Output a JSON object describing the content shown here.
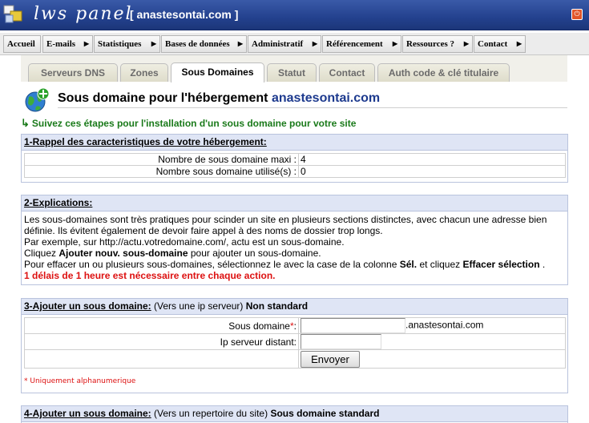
{
  "header": {
    "logo_text": "lws panel",
    "domain_title": "[ anastesontai.com ]",
    "power_icon": "power-icon"
  },
  "menu": [
    {
      "label": "Accueil"
    },
    {
      "label": "E-mails"
    },
    {
      "label": "Statistiques"
    },
    {
      "label": "Bases de données"
    },
    {
      "label": "Administratif"
    },
    {
      "label": "Référencement"
    },
    {
      "label": "Ressources ?"
    },
    {
      "label": "Contact"
    }
  ],
  "tabs": [
    {
      "label": "Serveurs DNS"
    },
    {
      "label": "Zones"
    },
    {
      "label": "Sous Domaines",
      "active": true
    },
    {
      "label": "Statut"
    },
    {
      "label": "Contact"
    },
    {
      "label": "Auth code & clé titulaire"
    }
  ],
  "page": {
    "heading": "Sous domaine pour l'hébergement",
    "heading_domain": "anastesontai.com",
    "steps_text": "Suivez ces étapes pour l'installation d'un sous domaine pour votre site"
  },
  "section1": {
    "title": "1-Rappel des caracteristiques de votre hébergement:",
    "rows": [
      {
        "label": "Nombre de sous domaine maxi :",
        "value": "4"
      },
      {
        "label": "Nombre sous domaine utilisé(s) :",
        "value": "0"
      }
    ]
  },
  "section2": {
    "title": "2-Explications:",
    "line1": "Les sous-domaines sont très pratiques pour scinder un site en plusieurs sections distinctes, avec chacun une adresse bien définie. Ils évitent également de devoir faire appel à des noms de dossier trop longs.",
    "line2": "Par exemple, sur http://actu.votredomaine.com/, actu est un sous-domaine.",
    "line3_pre": "Cliquez",
    "line3_bold": "Ajouter nouv. sous-domaine",
    "line3_post": "pour ajouter un sous-domaine.",
    "line4_pre": "Pour effacer un ou plusieurs sous-domaines, sélectionnez le avec la case de la colonne",
    "line4_bold1": "Sél.",
    "line4_mid": "et cliquez",
    "line4_bold2": "Effacer sélection",
    "line4_post": ".",
    "warning": "1 délais de 1 heure est nécessaire entre chaque action."
  },
  "section3": {
    "title": "3-Ajouter un sous domaine:",
    "title_paren": "(Vers une ip serveur)",
    "title_bold": "Non standard",
    "subdomain_label": "Sous domaine",
    "required_star": "*",
    "colon": ":",
    "subdomain_value": "",
    "domain_suffix": ".anastesontai.com",
    "ip_label": "Ip serveur distant:",
    "ip_value": "",
    "submit_label": "Envoyer",
    "note": "* Uniquement alphanumerique"
  },
  "section4": {
    "title": "4-Ajouter un sous domaine:",
    "title_paren": "(Vers un repertoire du site)",
    "title_bold": "Sous domaine standard"
  }
}
